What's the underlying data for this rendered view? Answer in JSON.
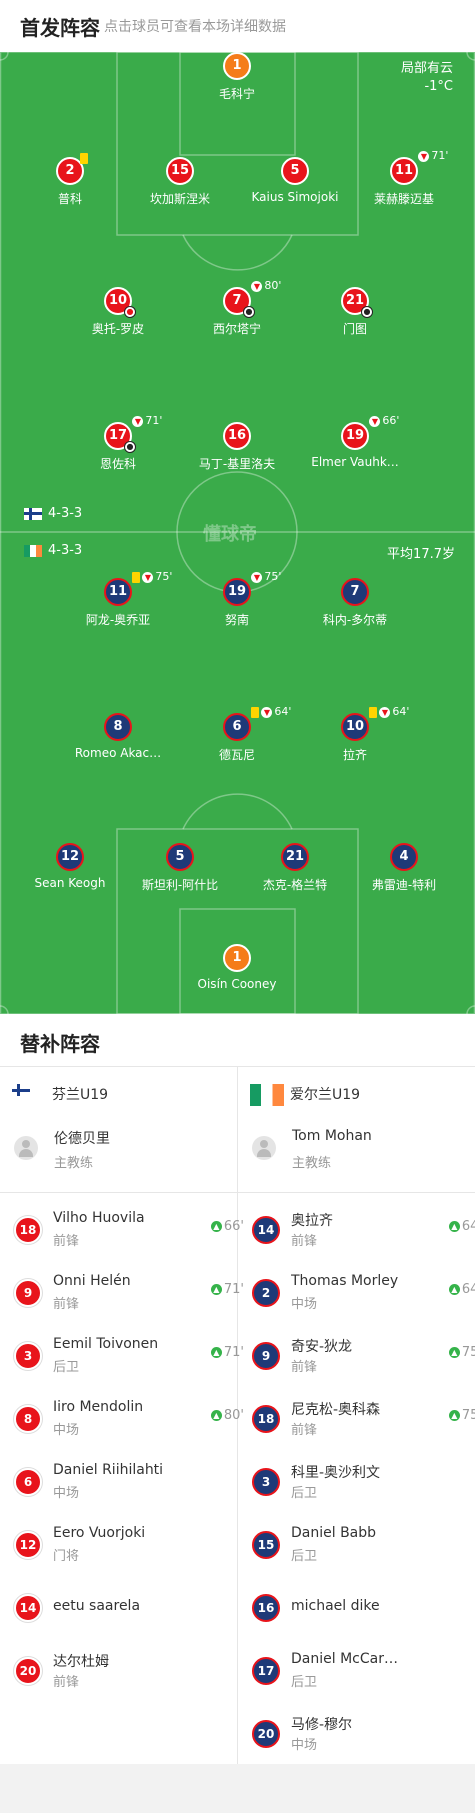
{
  "header": {
    "title": "首发阵容",
    "subtitle": "点击球员可查看本场详细数据"
  },
  "pitch": {
    "weather": "局部有云",
    "temperature": "-1°C",
    "watermark": "懂球帝",
    "home_formation": "4-3-3",
    "away_formation": "4-3-3",
    "away_avg_age": "平均17.7岁",
    "home_players": [
      {
        "num": "1",
        "name": "毛科宁",
        "color": "orange"
      },
      {
        "num": "2",
        "name": "普科",
        "events": "yellow"
      },
      {
        "num": "15",
        "name": "坎加斯涅米"
      },
      {
        "num": "5",
        "name": "Kaius Simojoki"
      },
      {
        "num": "11",
        "name": "莱赫滕迈基",
        "sub_off": "71'"
      },
      {
        "num": "10",
        "name": "奥托-罗皮",
        "goal": "own"
      },
      {
        "num": "7",
        "name": "西尔塔宁",
        "sub_off": "80'",
        "goal": "goal"
      },
      {
        "num": "21",
        "name": "门图",
        "goal": "goal"
      },
      {
        "num": "17",
        "name": "恩佐科",
        "sub_off": "71'",
        "goal": "goal"
      },
      {
        "num": "16",
        "name": "马丁-基里洛夫"
      },
      {
        "num": "19",
        "name": "Elmer Vauhk…",
        "sub_off": "66'"
      }
    ],
    "away_players": [
      {
        "num": "11",
        "name": "阿龙-奥乔亚",
        "card": "yellow",
        "sub_off": "75'"
      },
      {
        "num": "19",
        "name": "努南",
        "sub_off": "75'"
      },
      {
        "num": "7",
        "name": "科内-多尔蒂"
      },
      {
        "num": "8",
        "name": "Romeo Akac…"
      },
      {
        "num": "6",
        "name": "德瓦尼",
        "card": "yellow",
        "sub_off": "64'"
      },
      {
        "num": "10",
        "name": "拉齐",
        "card": "yellow",
        "sub_off": "64'"
      },
      {
        "num": "12",
        "name": "Sean Keogh"
      },
      {
        "num": "5",
        "name": "斯坦利-阿什比"
      },
      {
        "num": "21",
        "name": "杰克-格兰特"
      },
      {
        "num": "4",
        "name": "弗雷迪-特利"
      },
      {
        "num": "1",
        "name": "Oisín Cooney",
        "color": "orange"
      }
    ]
  },
  "subs": {
    "title": "替补阵容",
    "home": {
      "team": "芬兰U19",
      "coach_name": "伦德贝里",
      "coach_role": "主教练",
      "players": [
        {
          "num": "18",
          "name": "Vilho Huovila",
          "pos": "前锋",
          "min": "66'"
        },
        {
          "num": "9",
          "name": "Onni Helén",
          "pos": "前锋",
          "min": "71'"
        },
        {
          "num": "3",
          "name": "Eemil Toivonen",
          "pos": "后卫",
          "min": "71'"
        },
        {
          "num": "8",
          "name": "Iiro Mendolin",
          "pos": "中场",
          "min": "80'"
        },
        {
          "num": "6",
          "name": "Daniel Riihilahti",
          "pos": "中场",
          "min": ""
        },
        {
          "num": "12",
          "name": "Eero Vuorjoki",
          "pos": "门将",
          "min": ""
        },
        {
          "num": "14",
          "name": "eetu saarela",
          "pos": "",
          "min": ""
        },
        {
          "num": "20",
          "name": "达尔杜姆",
          "pos": "前锋",
          "min": ""
        }
      ]
    },
    "away": {
      "team": "爱尔兰U19",
      "coach_name": "Tom Mohan",
      "coach_role": "主教练",
      "players": [
        {
          "num": "14",
          "name": "奥拉齐",
          "pos": "前锋",
          "min": "64'"
        },
        {
          "num": "2",
          "name": "Thomas Morley",
          "pos": "中场",
          "min": "64'"
        },
        {
          "num": "9",
          "name": "奇安-狄龙",
          "pos": "前锋",
          "min": "75'"
        },
        {
          "num": "18",
          "name": "尼克松-奥科森",
          "pos": "前锋",
          "min": "75'"
        },
        {
          "num": "3",
          "name": "科里-奥沙利文",
          "pos": "后卫",
          "min": ""
        },
        {
          "num": "15",
          "name": "Daniel Babb",
          "pos": "后卫",
          "min": ""
        },
        {
          "num": "16",
          "name": "michael dike",
          "pos": "",
          "min": ""
        },
        {
          "num": "17",
          "name": "Daniel McCar…",
          "pos": "后卫",
          "min": ""
        },
        {
          "num": "20",
          "name": "马修-穆尔",
          "pos": "中场",
          "min": ""
        }
      ]
    }
  }
}
